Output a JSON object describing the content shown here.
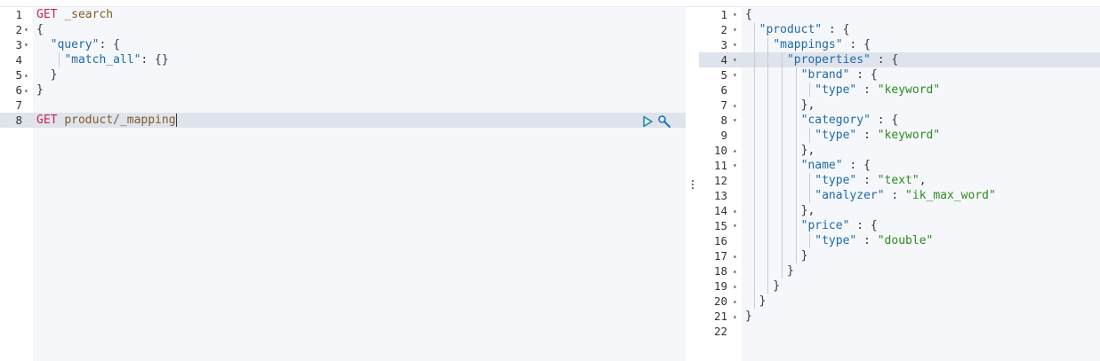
{
  "request": {
    "lines": [
      {
        "num": "1",
        "fold": "",
        "segments": [
          {
            "t": "GET",
            "c": "kw"
          },
          {
            "t": " ",
            "c": "punc"
          },
          {
            "t": "_search",
            "c": "url"
          }
        ]
      },
      {
        "num": "2",
        "fold": "▾",
        "segments": [
          {
            "t": "{",
            "c": "punc"
          }
        ]
      },
      {
        "num": "3",
        "fold": "▾",
        "segments": [
          {
            "t": "  ",
            "c": "punc"
          },
          {
            "t": "\"query\"",
            "c": "key"
          },
          {
            "t": ": {",
            "c": "punc"
          }
        ]
      },
      {
        "num": "4",
        "fold": "",
        "segments": [
          {
            "t": "    ",
            "c": "punc"
          },
          {
            "t": "\"match_all\"",
            "c": "key"
          },
          {
            "t": ": {}",
            "c": "punc"
          }
        ]
      },
      {
        "num": "5",
        "fold": "▴",
        "segments": [
          {
            "t": "  }",
            "c": "punc"
          }
        ]
      },
      {
        "num": "6",
        "fold": "▴",
        "segments": [
          {
            "t": "}",
            "c": "punc"
          }
        ]
      },
      {
        "num": "7",
        "fold": "",
        "segments": []
      },
      {
        "num": "8",
        "fold": "",
        "segments": [
          {
            "t": "GET",
            "c": "kw"
          },
          {
            "t": " ",
            "c": "punc"
          },
          {
            "t": "product/_mapping",
            "c": "url"
          }
        ]
      }
    ],
    "active_line": 8
  },
  "response": {
    "lines": [
      {
        "num": "1",
        "fold": "▾",
        "segments": [
          {
            "t": "{",
            "c": "punc"
          }
        ]
      },
      {
        "num": "2",
        "fold": "▾",
        "segments": [
          {
            "t": "  ",
            "c": "punc"
          },
          {
            "t": "\"product\"",
            "c": "key"
          },
          {
            "t": " : {",
            "c": "punc"
          }
        ]
      },
      {
        "num": "3",
        "fold": "▾",
        "segments": [
          {
            "t": "    ",
            "c": "punc"
          },
          {
            "t": "\"mappings\"",
            "c": "key"
          },
          {
            "t": " : {",
            "c": "punc"
          }
        ]
      },
      {
        "num": "4",
        "fold": "▾",
        "segments": [
          {
            "t": "      ",
            "c": "punc"
          },
          {
            "t": "\"properties\"",
            "c": "key"
          },
          {
            "t": " : {",
            "c": "punc"
          }
        ]
      },
      {
        "num": "5",
        "fold": "▾",
        "segments": [
          {
            "t": "        ",
            "c": "punc"
          },
          {
            "t": "\"brand\"",
            "c": "key"
          },
          {
            "t": " : {",
            "c": "punc"
          }
        ]
      },
      {
        "num": "6",
        "fold": "",
        "segments": [
          {
            "t": "          ",
            "c": "punc"
          },
          {
            "t": "\"type\"",
            "c": "key"
          },
          {
            "t": " : ",
            "c": "punc"
          },
          {
            "t": "\"keyword\"",
            "c": "str"
          }
        ]
      },
      {
        "num": "7",
        "fold": "▴",
        "segments": [
          {
            "t": "        },",
            "c": "punc"
          }
        ]
      },
      {
        "num": "8",
        "fold": "▾",
        "segments": [
          {
            "t": "        ",
            "c": "punc"
          },
          {
            "t": "\"category\"",
            "c": "key"
          },
          {
            "t": " : {",
            "c": "punc"
          }
        ]
      },
      {
        "num": "9",
        "fold": "",
        "segments": [
          {
            "t": "          ",
            "c": "punc"
          },
          {
            "t": "\"type\"",
            "c": "key"
          },
          {
            "t": " : ",
            "c": "punc"
          },
          {
            "t": "\"keyword\"",
            "c": "str"
          }
        ]
      },
      {
        "num": "10",
        "fold": "▴",
        "segments": [
          {
            "t": "        },",
            "c": "punc"
          }
        ]
      },
      {
        "num": "11",
        "fold": "▾",
        "segments": [
          {
            "t": "        ",
            "c": "punc"
          },
          {
            "t": "\"name\"",
            "c": "key"
          },
          {
            "t": " : {",
            "c": "punc"
          }
        ]
      },
      {
        "num": "12",
        "fold": "",
        "segments": [
          {
            "t": "          ",
            "c": "punc"
          },
          {
            "t": "\"type\"",
            "c": "key"
          },
          {
            "t": " : ",
            "c": "punc"
          },
          {
            "t": "\"text\"",
            "c": "str"
          },
          {
            "t": ",",
            "c": "punc"
          }
        ]
      },
      {
        "num": "13",
        "fold": "",
        "segments": [
          {
            "t": "          ",
            "c": "punc"
          },
          {
            "t": "\"analyzer\"",
            "c": "key"
          },
          {
            "t": " : ",
            "c": "punc"
          },
          {
            "t": "\"ik_max_word\"",
            "c": "str"
          }
        ]
      },
      {
        "num": "14",
        "fold": "▴",
        "segments": [
          {
            "t": "        },",
            "c": "punc"
          }
        ]
      },
      {
        "num": "15",
        "fold": "▾",
        "segments": [
          {
            "t": "        ",
            "c": "punc"
          },
          {
            "t": "\"price\"",
            "c": "key"
          },
          {
            "t": " : {",
            "c": "punc"
          }
        ]
      },
      {
        "num": "16",
        "fold": "",
        "segments": [
          {
            "t": "          ",
            "c": "punc"
          },
          {
            "t": "\"type\"",
            "c": "key"
          },
          {
            "t": " : ",
            "c": "punc"
          },
          {
            "t": "\"double\"",
            "c": "str"
          }
        ]
      },
      {
        "num": "17",
        "fold": "▴",
        "segments": [
          {
            "t": "        }",
            "c": "punc"
          }
        ]
      },
      {
        "num": "18",
        "fold": "▴",
        "segments": [
          {
            "t": "      }",
            "c": "punc"
          }
        ]
      },
      {
        "num": "19",
        "fold": "▴",
        "segments": [
          {
            "t": "    }",
            "c": "punc"
          }
        ]
      },
      {
        "num": "20",
        "fold": "▴",
        "segments": [
          {
            "t": "  }",
            "c": "punc"
          }
        ]
      },
      {
        "num": "21",
        "fold": "▴",
        "segments": [
          {
            "t": "}",
            "c": "punc"
          }
        ]
      },
      {
        "num": "22",
        "fold": "",
        "segments": []
      }
    ],
    "active_line": 4
  },
  "icons": {
    "run": "play-icon",
    "settings": "wrench-icon",
    "splitter": "vertical-dots-icon"
  },
  "colors": {
    "keyword": "#c7254e",
    "key": "#1e6aa8",
    "string": "#2e8b1f",
    "active_line": "#dfe3ec"
  }
}
